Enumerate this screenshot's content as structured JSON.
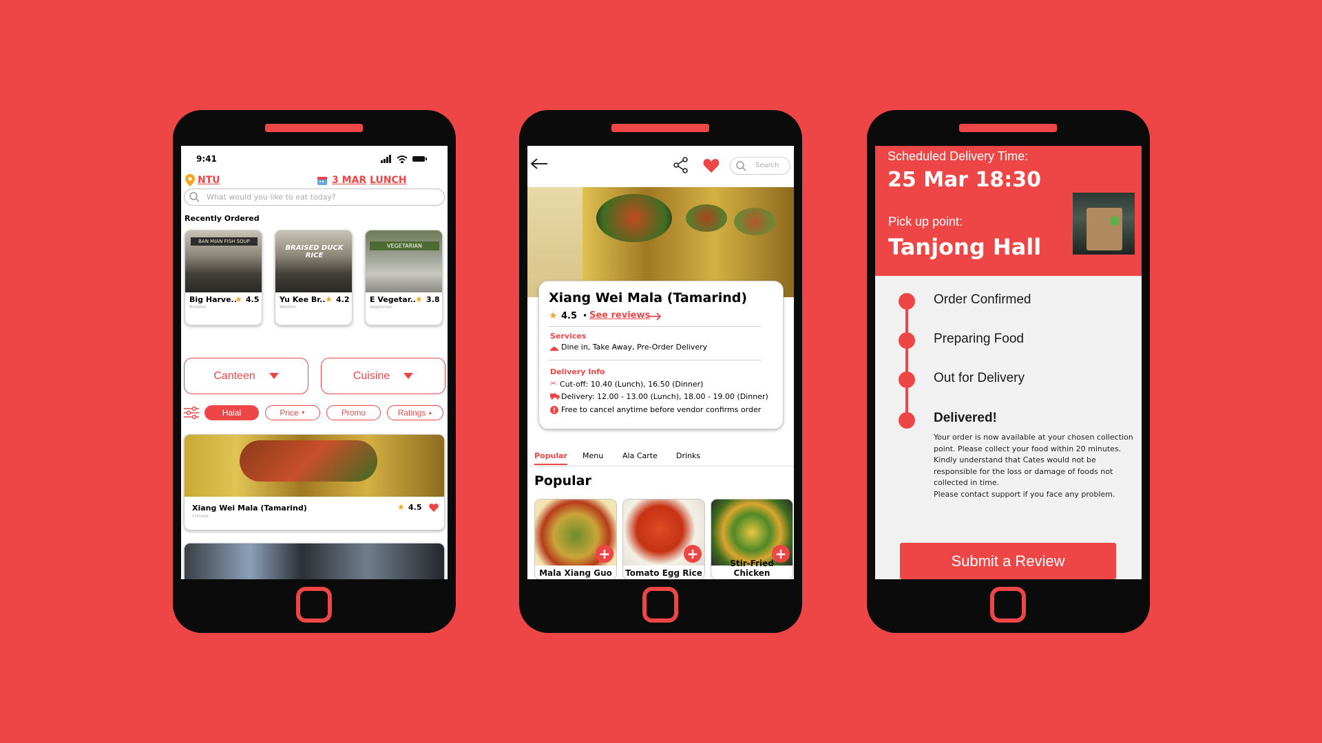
{
  "colors": {
    "brand": "#ee4646",
    "star": "#f5a623",
    "text": "#1a1a1a"
  },
  "home": {
    "status": {
      "time": "9:41"
    },
    "location": "NTU",
    "date": "3 MAR",
    "meal": "LUNCH",
    "search_placeholder": "What would you like to eat today?",
    "recent_title": "Recently Ordered",
    "recent": [
      {
        "name": "Big Harve..",
        "rating": "4.5",
        "category": "Noodles",
        "sign": "BAN MIAN FISH SOUP"
      },
      {
        "name": "Yu Kee Br..",
        "rating": "4.2",
        "category": "Western",
        "sign": "BRAISED DUCK RICE"
      },
      {
        "name": "E Vegetar..",
        "rating": "3.8",
        "category": "Vegetarian",
        "sign": "VEGETARIAN"
      }
    ],
    "dropdowns": {
      "canteen": "Canteen",
      "cuisine": "Cuisine"
    },
    "filters": {
      "halal": "Halal",
      "price": "Price",
      "promo": "Promo",
      "ratings": "Ratings"
    },
    "featured": {
      "name": "Xiang Wei Mala (Tamarind)",
      "category": "Chinese",
      "rating": "4.5"
    }
  },
  "store": {
    "search_placeholder": "Search",
    "name": "Xiang Wei Mala (Tamarind)",
    "rating": "4.5",
    "dot": "•",
    "see_reviews": "See reviews",
    "services_title": "Services",
    "services": "Dine in, Take Away, Pre-Order Delivery",
    "delivery_title": "Delivery Info",
    "cutoff": "Cut-off: 10.40 (Lunch), 16.50 (Dinner)",
    "delivery": "Delivery: 12.00 - 13.00 (Lunch), 18.00 - 19.00 (Dinner)",
    "cancel": "Free to cancel anytime before vendor confirms order",
    "tabs": [
      "Popular",
      "Menu",
      "Ala Carte",
      "Drinks"
    ],
    "section_title": "Popular",
    "dishes": [
      {
        "name": "Mala Xiang Guo"
      },
      {
        "name": "Tomato Egg Rice"
      },
      {
        "name": "Stir-Fried Chicken"
      }
    ]
  },
  "tracking": {
    "scheduled_label": "Scheduled Delivery Time:",
    "scheduled_time": "25 Mar 18:30",
    "pickup_label": "Pick up point:",
    "pickup_place": "Tanjong Hall",
    "steps": [
      "Order Confirmed",
      "Preparing Food",
      "Out for Delivery",
      "Delivered!"
    ],
    "delivered_note": [
      "Your order is now available at your chosen collection point. Please collect your food within 20 minutes.",
      "Kindly understand that Cates would not be responsible for the loss or damage of foods not collected in time.",
      "Please contact support if you face any problem."
    ],
    "submit": "Submit a Review"
  }
}
